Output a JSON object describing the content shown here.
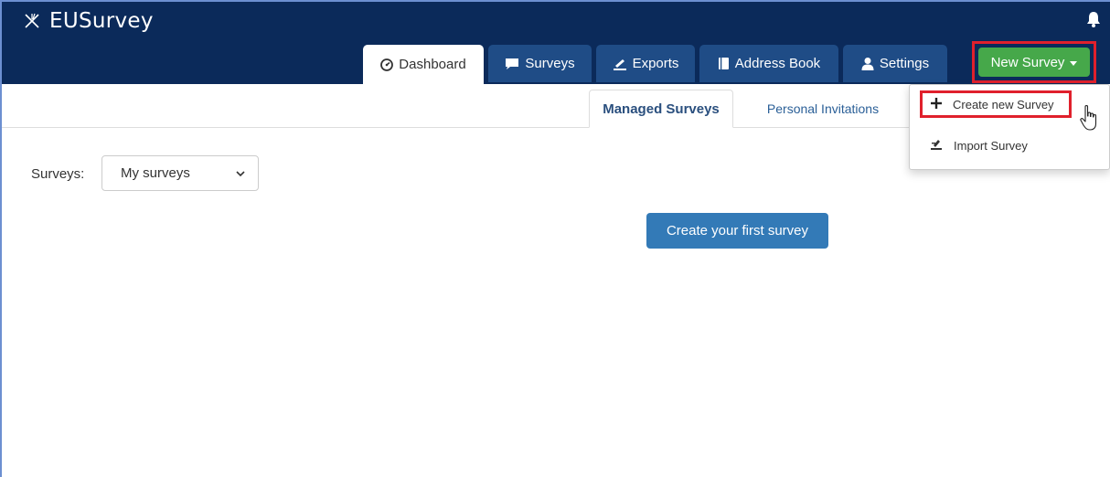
{
  "app": {
    "logo_text": "EUSurvey",
    "logo_icon": "star-burst-icon",
    "bell_icon": "bell-icon"
  },
  "nav": {
    "tabs": [
      {
        "label": "Dashboard",
        "icon": "dashboard-icon",
        "active": true
      },
      {
        "label": "Surveys",
        "icon": "comment-icon",
        "active": false
      },
      {
        "label": "Exports",
        "icon": "export-icon",
        "active": false
      },
      {
        "label": "Address Book",
        "icon": "book-icon",
        "active": false
      },
      {
        "label": "Settings",
        "icon": "user-icon",
        "active": false
      }
    ],
    "new_survey_label": "New Survey"
  },
  "subtabs": [
    {
      "label": "Managed Surveys",
      "active": true
    },
    {
      "label": "Personal Invitations",
      "active": false
    }
  ],
  "filter": {
    "label": "Surveys:",
    "selected": "My surveys"
  },
  "main": {
    "create_first_label": "Create your first survey"
  },
  "dropdown": {
    "items": [
      {
        "label": "Create new Survey",
        "icon": "plus-icon"
      },
      {
        "label": "Import Survey",
        "icon": "import-icon"
      }
    ]
  },
  "colors": {
    "topbar": "#0b2a5a",
    "nav_tab": "#1f4c86",
    "new_survey": "#46a84a",
    "primary_button": "#337ab7",
    "highlight_border": "#e0202c"
  }
}
